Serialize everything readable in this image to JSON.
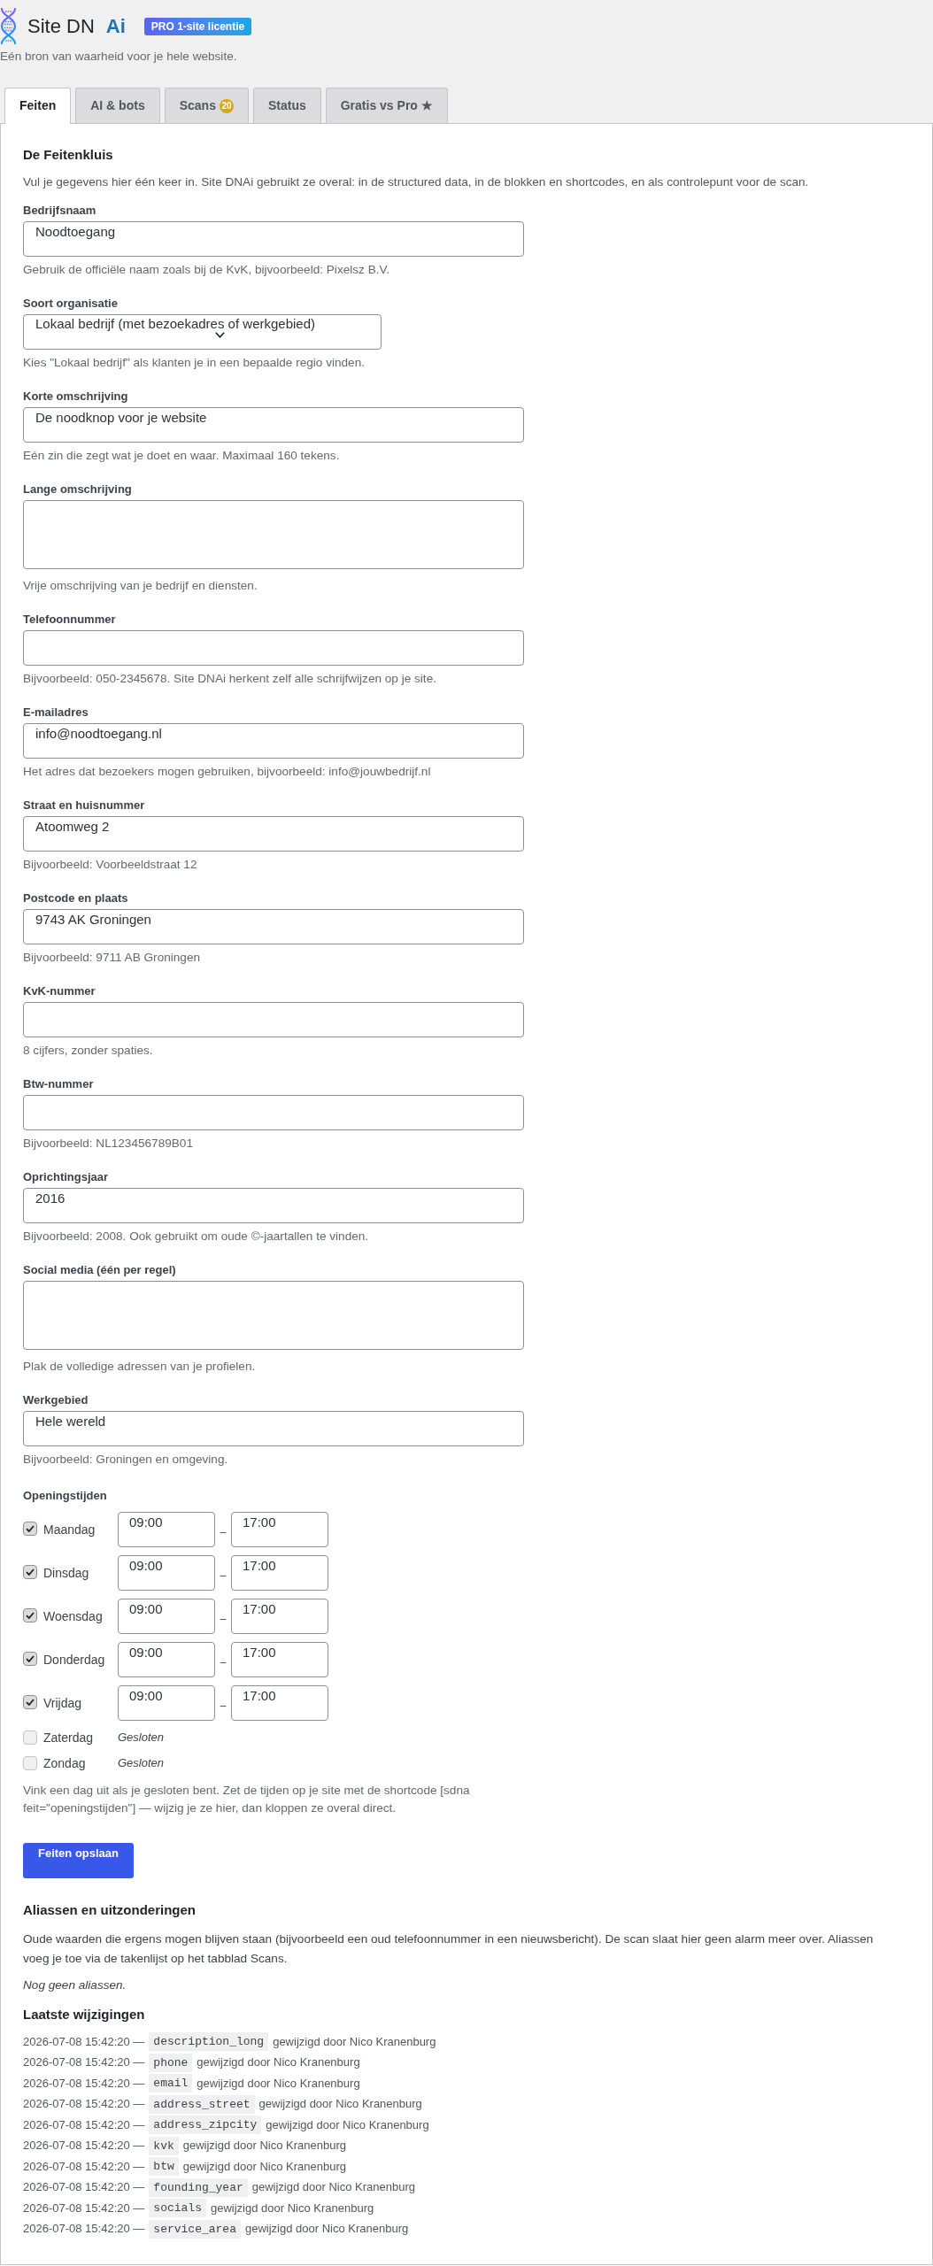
{
  "header": {
    "brand": "Site DN",
    "brand_suffix": "Ai",
    "license_badge": "PRO 1-site licentie",
    "tagline": "Eén bron van waarheid voor je hele website."
  },
  "tabs": [
    {
      "label": "Feiten",
      "selected": true
    },
    {
      "label": "AI & bots",
      "selected": false
    },
    {
      "label": "Scans",
      "selected": false,
      "badge": "20"
    },
    {
      "label": "Status",
      "selected": false
    },
    {
      "label": "Gratis vs Pro ★",
      "selected": false
    }
  ],
  "facts": {
    "title": "De Feitenkluis",
    "intro": "Vul je gegevens hier één keer in. Site DNAi gebruikt ze overal: in de structured data, in de blokken en shortcodes, en als controlepunt voor de scan.",
    "fields": [
      {
        "kind": "input",
        "label": "Bedrijfsnaam",
        "value": "Noodtoegang",
        "hint": "Gebruik de officiële naam zoals bij de KvK, bijvoorbeeld: Pixelsz B.V."
      },
      {
        "kind": "select",
        "label": "Soort organisatie",
        "value": "Lokaal bedrijf (met bezoekadres of werkgebied)",
        "hint": "Kies \"Lokaal bedrijf\" als klanten je in een bepaalde regio vinden."
      },
      {
        "kind": "input",
        "label": "Korte omschrijving",
        "value": "De noodknop voor je website",
        "hint": "Eén zin die zegt wat je doet en waar. Maximaal 160 tekens."
      },
      {
        "kind": "textarea",
        "label": "Lange omschrijving",
        "hint": "Vrije omschrijving van je bedrijf en diensten."
      },
      {
        "kind": "input",
        "label": "Telefoonnummer",
        "hint": "Bijvoorbeeld: 050-2345678. Site DNAi herkent zelf alle schrijfwijzen op je site."
      },
      {
        "kind": "input",
        "label": "E-mailadres",
        "value": "info@noodtoegang.nl",
        "hint": "Het adres dat bezoekers mogen gebruiken, bijvoorbeeld: info@jouwbedrijf.nl"
      },
      {
        "kind": "input",
        "label": "Straat en huisnummer",
        "value": "Atoomweg 2",
        "hint": "Bijvoorbeeld: Voorbeeldstraat 12"
      },
      {
        "kind": "input",
        "label": "Postcode en plaats",
        "value": "9743 AK Groningen",
        "hint": "Bijvoorbeeld: 9711 AB Groningen"
      },
      {
        "kind": "input",
        "label": "KvK-nummer",
        "hint": "8 cijfers, zonder spaties."
      },
      {
        "kind": "input",
        "label": "Btw-nummer",
        "hint": "Bijvoorbeeld: NL123456789B01"
      },
      {
        "kind": "input",
        "label": "Oprichtingsjaar",
        "value": "2016",
        "hint": "Bijvoorbeeld: 2008. Ook gebruikt om oude ©-jaartallen te vinden."
      },
      {
        "kind": "textarea",
        "label": "Social media (één per regel)",
        "hint": "Plak de volledige adressen van je profielen."
      },
      {
        "kind": "input",
        "label": "Werkgebied",
        "value": "Hele wereld",
        "hint": "Bijvoorbeeld: Groningen en omgeving."
      }
    ]
  },
  "opening_hours": {
    "label": "Openingstijden",
    "days": [
      {
        "day": "Maandag",
        "checked": true,
        "open": "09:00",
        "separator": "–",
        "close": "17:00"
      },
      {
        "day": "Dinsdag",
        "checked": true,
        "open": "09:00",
        "separator": "–",
        "close": "17:00"
      },
      {
        "day": "Woensdag",
        "checked": true,
        "open": "09:00",
        "separator": "–",
        "close": "17:00"
      },
      {
        "day": "Donderdag",
        "checked": true,
        "open": "09:00",
        "separator": "–",
        "close": "17:00"
      },
      {
        "day": "Vrijdag",
        "checked": true,
        "open": "09:00",
        "separator": "–",
        "close": "17:00"
      },
      {
        "day": "Zaterdag",
        "checked": false,
        "note": "Gesloten"
      },
      {
        "day": "Zondag",
        "checked": false,
        "note": "Gesloten"
      }
    ],
    "hint": "Vink een dag uit als je gesloten bent. Zet de tijden op je site met de shortcode [sdna feit=\"openingstijden\"] — wijzig je ze hier, dan kloppen ze overal direct."
  },
  "save_button": "Feiten opslaan",
  "aliases": {
    "title": "Aliassen en uitzonderingen",
    "text": "Oude waarden die ergens mogen blijven staan (bijvoorbeeld een oud telefoonnummer in een nieuwsbericht). De scan slaat hier geen alarm meer over. Aliassen voeg je toe via de takenlijst op het tabblad Scans.",
    "empty_note": "Nog geen aliassen."
  },
  "changes": {
    "title": "Laatste wijzigingen",
    "rows": [
      {
        "timestamp": "2026-07-08 15:42:20 —",
        "field": "description_long",
        "by": "gewijzigd door Nico Kranenburg"
      },
      {
        "timestamp": "2026-07-08 15:42:20 —",
        "field": "phone",
        "by": "gewijzigd door Nico Kranenburg"
      },
      {
        "timestamp": "2026-07-08 15:42:20 —",
        "field": "email",
        "by": "gewijzigd door Nico Kranenburg"
      },
      {
        "timestamp": "2026-07-08 15:42:20 —",
        "field": "address_street",
        "by": "gewijzigd door Nico Kranenburg"
      },
      {
        "timestamp": "2026-07-08 15:42:20 —",
        "field": "address_zipcity",
        "by": "gewijzigd door Nico Kranenburg"
      },
      {
        "timestamp": "2026-07-08 15:42:20 —",
        "field": "kvk",
        "by": "gewijzigd door Nico Kranenburg"
      },
      {
        "timestamp": "2026-07-08 15:42:20 —",
        "field": "btw",
        "by": "gewijzigd door Nico Kranenburg"
      },
      {
        "timestamp": "2026-07-08 15:42:20 —",
        "field": "founding_year",
        "by": "gewijzigd door Nico Kranenburg"
      },
      {
        "timestamp": "2026-07-08 15:42:20 —",
        "field": "socials",
        "by": "gewijzigd door Nico Kranenburg"
      },
      {
        "timestamp": "2026-07-08 15:42:20 —",
        "field": "service_area",
        "by": "gewijzigd door Nico Kranenburg"
      }
    ]
  }
}
